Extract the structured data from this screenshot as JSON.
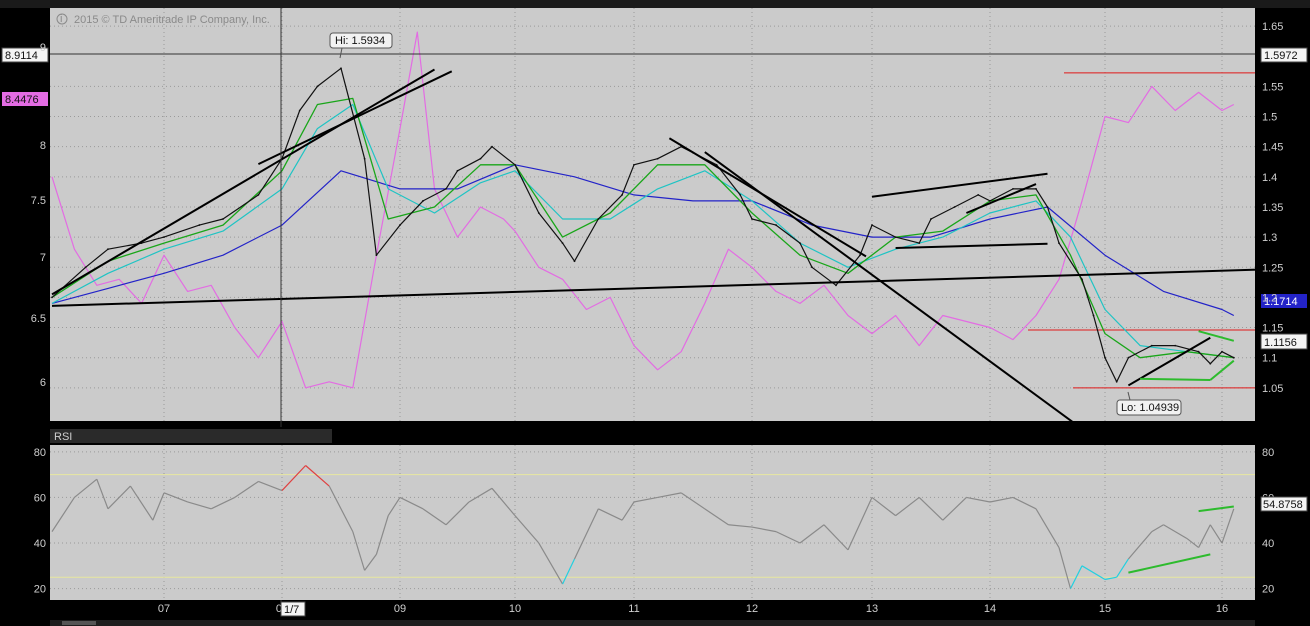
{
  "watermark": "2015 © TD Ameritrade IP Company, Inc.",
  "colors": {
    "panel_bg": "#cbcbcb",
    "frame_bg": "#000000",
    "price": "#111111",
    "ema_fast": "#19a619",
    "ema_mid": "#1fc4c4",
    "ma_long": "#2323c8",
    "overlay": "#e36ce3",
    "level": "#e01818",
    "trendline": "#000000",
    "rsi": "#8a8a8a",
    "rsi_ob": "#e04040",
    "rsi_os": "#22d0e0",
    "rsi_band": "#e8e8a0",
    "wedge": "#2dbb2d"
  },
  "chart_data": [
    {
      "type": "line",
      "title": "",
      "left_axis": {
        "ticks": [
          6,
          6.5,
          7,
          7.5,
          8,
          9
        ],
        "tick_labels": [
          "6",
          "6.5",
          "7",
          "7.5",
          "8",
          "9"
        ]
      },
      "right_axis": {
        "ticks": [
          1.05,
          1.1,
          1.15,
          1.2,
          1.25,
          1.3,
          1.35,
          1.4,
          1.45,
          1.5,
          1.55,
          1.65
        ],
        "tick_labels": [
          "1.05",
          "1.1",
          "1.15",
          "1.2",
          "1.25",
          "1.3",
          "1.35",
          "1.4",
          "1.45",
          "1.5",
          "1.55",
          "1.65"
        ],
        "ylim": [
          0.995,
          1.68
        ]
      },
      "x_ticks": [
        "07",
        "08",
        "09",
        "10",
        "11",
        "12",
        "13",
        "14",
        "15",
        "16"
      ],
      "cursor_label": "1/7",
      "annotations": {
        "hi": "Hi: 1.5934",
        "lo": "Lo: 1.04939"
      },
      "price_tags": {
        "left_cursor": "8.9114",
        "left_overlay": "8.4476",
        "right_cursor": "1.5972",
        "right_ma": "1.1714",
        "right_last": "1.1156"
      },
      "reference_levels": [
        1.5725,
        1.146,
        1.05
      ],
      "series": [
        {
          "role": "price",
          "x": [
            "06.0",
            "06.3",
            "06.5",
            "06.8",
            "07.0",
            "07.3",
            "07.5",
            "07.8",
            "08.0",
            "08.15",
            "08.3",
            "08.5",
            "08.7",
            "08.8",
            "09.0",
            "09.2",
            "09.4",
            "09.5",
            "09.7",
            "09.8",
            "10.0",
            "10.2",
            "10.4",
            "10.5",
            "10.7",
            "10.9",
            "11.0",
            "11.2",
            "11.4",
            "11.5",
            "11.7",
            "11.9",
            "12.0",
            "12.2",
            "12.4",
            "12.5",
            "12.7",
            "12.9",
            "13.0",
            "13.2",
            "13.4",
            "13.5",
            "13.7",
            "13.9",
            "14.0",
            "14.2",
            "14.4",
            "14.5",
            "14.6",
            "14.8",
            "14.9",
            "15.0",
            "15.1",
            "15.2",
            "15.4",
            "15.6",
            "15.8",
            "15.9",
            "16.0",
            "16.1"
          ],
          "values": [
            1.2,
            1.25,
            1.28,
            1.29,
            1.3,
            1.32,
            1.33,
            1.37,
            1.43,
            1.51,
            1.55,
            1.58,
            1.43,
            1.27,
            1.32,
            1.36,
            1.38,
            1.41,
            1.43,
            1.45,
            1.42,
            1.34,
            1.29,
            1.26,
            1.33,
            1.37,
            1.42,
            1.43,
            1.45,
            1.44,
            1.42,
            1.37,
            1.33,
            1.32,
            1.29,
            1.25,
            1.22,
            1.27,
            1.32,
            1.3,
            1.29,
            1.33,
            1.35,
            1.37,
            1.36,
            1.38,
            1.38,
            1.35,
            1.29,
            1.23,
            1.17,
            1.1,
            1.06,
            1.1,
            1.12,
            1.12,
            1.11,
            1.09,
            1.11,
            1.1
          ]
        },
        {
          "role": "ema_fast",
          "x": [
            "06.0",
            "06.5",
            "07.0",
            "07.5",
            "08.0",
            "08.3",
            "08.6",
            "08.9",
            "09.3",
            "09.7",
            "10.0",
            "10.4",
            "10.8",
            "11.2",
            "11.6",
            "12.0",
            "12.4",
            "12.8",
            "13.2",
            "13.6",
            "14.0",
            "14.4",
            "14.7",
            "15.0",
            "15.3",
            "15.7",
            "16.1"
          ],
          "values": [
            1.2,
            1.26,
            1.29,
            1.32,
            1.41,
            1.52,
            1.53,
            1.33,
            1.35,
            1.42,
            1.42,
            1.3,
            1.34,
            1.42,
            1.42,
            1.34,
            1.27,
            1.24,
            1.3,
            1.31,
            1.36,
            1.37,
            1.27,
            1.14,
            1.1,
            1.11,
            1.1
          ]
        },
        {
          "role": "ema_mid",
          "x": [
            "06.0",
            "06.5",
            "07.0",
            "07.5",
            "08.0",
            "08.3",
            "08.6",
            "08.9",
            "09.3",
            "09.7",
            "10.0",
            "10.4",
            "10.8",
            "11.2",
            "11.6",
            "12.0",
            "12.4",
            "12.8",
            "13.2",
            "13.6",
            "14.0",
            "14.4",
            "14.7",
            "15.0",
            "15.3",
            "15.7",
            "16.1"
          ],
          "values": [
            1.19,
            1.24,
            1.28,
            1.31,
            1.38,
            1.48,
            1.52,
            1.38,
            1.34,
            1.39,
            1.41,
            1.33,
            1.33,
            1.38,
            1.41,
            1.36,
            1.29,
            1.25,
            1.28,
            1.3,
            1.34,
            1.36,
            1.3,
            1.18,
            1.12,
            1.11,
            1.1
          ]
        },
        {
          "role": "ma_long",
          "x": [
            "06.0",
            "06.5",
            "07.0",
            "07.5",
            "08.0",
            "08.5",
            "09.0",
            "09.5",
            "10.0",
            "10.5",
            "11.0",
            "11.5",
            "12.0",
            "12.5",
            "13.0",
            "13.5",
            "14.0",
            "14.5",
            "15.0",
            "15.5",
            "16.0",
            "16.1"
          ],
          "values": [
            1.19,
            1.215,
            1.24,
            1.27,
            1.32,
            1.41,
            1.38,
            1.38,
            1.42,
            1.4,
            1.37,
            1.36,
            1.36,
            1.32,
            1.3,
            1.3,
            1.33,
            1.35,
            1.27,
            1.21,
            1.18,
            1.17
          ]
        },
        {
          "role": "overlay",
          "x": [
            "06.0",
            "06.2",
            "06.4",
            "06.6",
            "06.8",
            "07.0",
            "07.2",
            "07.4",
            "07.6",
            "07.8",
            "08.0",
            "08.2",
            "08.4",
            "08.6",
            "08.8",
            "09.0",
            "09.15",
            "09.3",
            "09.5",
            "09.7",
            "09.9",
            "10.0",
            "10.2",
            "10.4",
            "10.6",
            "10.8",
            "11.0",
            "11.2",
            "11.4",
            "11.6",
            "11.8",
            "12.0",
            "12.2",
            "12.4",
            "12.6",
            "12.8",
            "13.0",
            "13.2",
            "13.4",
            "13.6",
            "13.8",
            "14.0",
            "14.2",
            "14.4",
            "14.6",
            "14.8",
            "15.0",
            "15.2",
            "15.4",
            "15.6",
            "15.8",
            "16.0",
            "16.1"
          ],
          "values": [
            1.4,
            1.28,
            1.22,
            1.23,
            1.19,
            1.27,
            1.21,
            1.22,
            1.15,
            1.1,
            1.16,
            1.05,
            1.06,
            1.05,
            1.27,
            1.48,
            1.64,
            1.38,
            1.3,
            1.35,
            1.33,
            1.31,
            1.25,
            1.23,
            1.18,
            1.2,
            1.12,
            1.08,
            1.11,
            1.19,
            1.28,
            1.25,
            1.21,
            1.19,
            1.22,
            1.17,
            1.14,
            1.17,
            1.12,
            1.17,
            1.16,
            1.15,
            1.13,
            1.17,
            1.23,
            1.36,
            1.5,
            1.49,
            1.55,
            1.51,
            1.54,
            1.51,
            1.52
          ]
        }
      ],
      "trendlines": [
        {
          "x": [
            "06.0",
            "09.3"
          ],
          "y": [
            1.205,
            1.578
          ]
        },
        {
          "x": [
            "06.0",
            "16.3"
          ],
          "y": [
            1.186,
            1.246
          ]
        },
        {
          "x": [
            "07.8",
            "09.45"
          ],
          "y": [
            1.421,
            1.575
          ]
        },
        {
          "x": [
            "11.3",
            "12.95"
          ],
          "y": [
            1.464,
            1.268
          ]
        },
        {
          "x": [
            "11.6",
            "14.85"
          ],
          "y": [
            1.441,
            0.975
          ]
        },
        {
          "x": [
            "13.0",
            "14.5"
          ],
          "y": [
            1.367,
            1.405
          ]
        },
        {
          "x": [
            "13.2",
            "14.5"
          ],
          "y": [
            1.282,
            1.289
          ]
        },
        {
          "x": [
            "13.8",
            "14.4"
          ],
          "y": [
            1.34,
            1.388
          ]
        },
        {
          "x": [
            "15.2",
            "15.9"
          ],
          "y": [
            1.054,
            1.133
          ]
        }
      ],
      "green_wedge": [
        {
          "x": [
            "15.3",
            "15.9"
          ],
          "y": [
            1.065,
            1.063
          ]
        },
        {
          "x": [
            "15.8",
            "16.1"
          ],
          "y": [
            1.144,
            1.128
          ]
        },
        {
          "x": [
            "15.9",
            "16.1"
          ],
          "y": [
            1.063,
            1.095
          ]
        }
      ]
    },
    {
      "type": "line",
      "title": "RSI",
      "ylim": [
        15,
        83
      ],
      "ticks": [
        20,
        40,
        60,
        80
      ],
      "tick_labels": [
        "20",
        "40",
        "60",
        "80"
      ],
      "bands": [
        70,
        25
      ],
      "last_value_label": "54.8758",
      "series": [
        {
          "role": "rsi",
          "x": [
            "06.0",
            "06.2",
            "06.4",
            "06.5",
            "06.7",
            "06.9",
            "07.0",
            "07.2",
            "07.4",
            "07.6",
            "07.8",
            "08.0",
            "08.2",
            "08.4",
            "08.6",
            "08.7",
            "08.8",
            "08.9",
            "09.0",
            "09.2",
            "09.4",
            "09.6",
            "09.8",
            "10.0",
            "10.2",
            "10.4",
            "10.5",
            "10.7",
            "10.9",
            "11.0",
            "11.2",
            "11.4",
            "11.6",
            "11.8",
            "12.0",
            "12.2",
            "12.4",
            "12.6",
            "12.8",
            "13.0",
            "13.2",
            "13.4",
            "13.6",
            "13.8",
            "14.0",
            "14.2",
            "14.4",
            "14.6",
            "14.7",
            "14.8",
            "15.0",
            "15.1",
            "15.2",
            "15.4",
            "15.5",
            "15.7",
            "15.8",
            "15.9",
            "16.0",
            "16.1"
          ],
          "values": [
            45,
            60,
            68,
            55,
            65,
            50,
            62,
            58,
            55,
            60,
            67,
            63,
            74,
            65,
            45,
            28,
            35,
            52,
            60,
            55,
            48,
            58,
            64,
            52,
            40,
            22,
            33,
            55,
            50,
            58,
            60,
            62,
            55,
            48,
            47,
            45,
            40,
            48,
            37,
            60,
            52,
            60,
            50,
            60,
            58,
            60,
            55,
            38,
            20,
            30,
            24,
            25,
            33,
            45,
            48,
            42,
            38,
            48,
            40,
            55
          ]
        }
      ],
      "green_divergence": [
        {
          "x": [
            "15.2",
            "15.9"
          ],
          "y": [
            27,
            35
          ]
        },
        {
          "x": [
            "15.8",
            "16.1"
          ],
          "y": [
            54,
            56
          ]
        }
      ]
    }
  ]
}
